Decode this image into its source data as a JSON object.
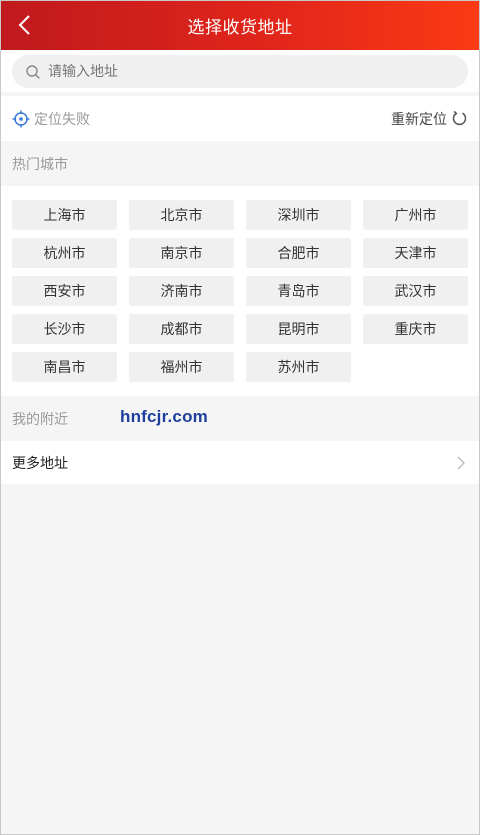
{
  "header": {
    "title": "选择收货地址",
    "back_icon": "chevron-left-icon"
  },
  "search": {
    "placeholder": "请输入地址",
    "value": "",
    "icon": "search-icon"
  },
  "location": {
    "status": "定位失败",
    "status_icon": "crosshair-icon",
    "relocate_label": "重新定位",
    "relocate_icon": "refresh-icon"
  },
  "hot_cities": {
    "label": "热门城市",
    "cities": [
      "上海市",
      "北京市",
      "深圳市",
      "广州市",
      "杭州市",
      "南京市",
      "合肥市",
      "天津市",
      "西安市",
      "济南市",
      "青岛市",
      "武汉市",
      "长沙市",
      "成都市",
      "昆明市",
      "重庆市",
      "南昌市",
      "福州市",
      "苏州市"
    ]
  },
  "nearby": {
    "label": "我的附近"
  },
  "watermark": "hnfcjr.com",
  "more": {
    "label": "更多地址",
    "icon": "chevron-right-icon"
  },
  "colors": {
    "header_gradient_start": "#c0191d",
    "header_gradient_end": "#fb3a14",
    "locate_icon": "#3a7bd5",
    "watermark": "#1d3f9e"
  }
}
